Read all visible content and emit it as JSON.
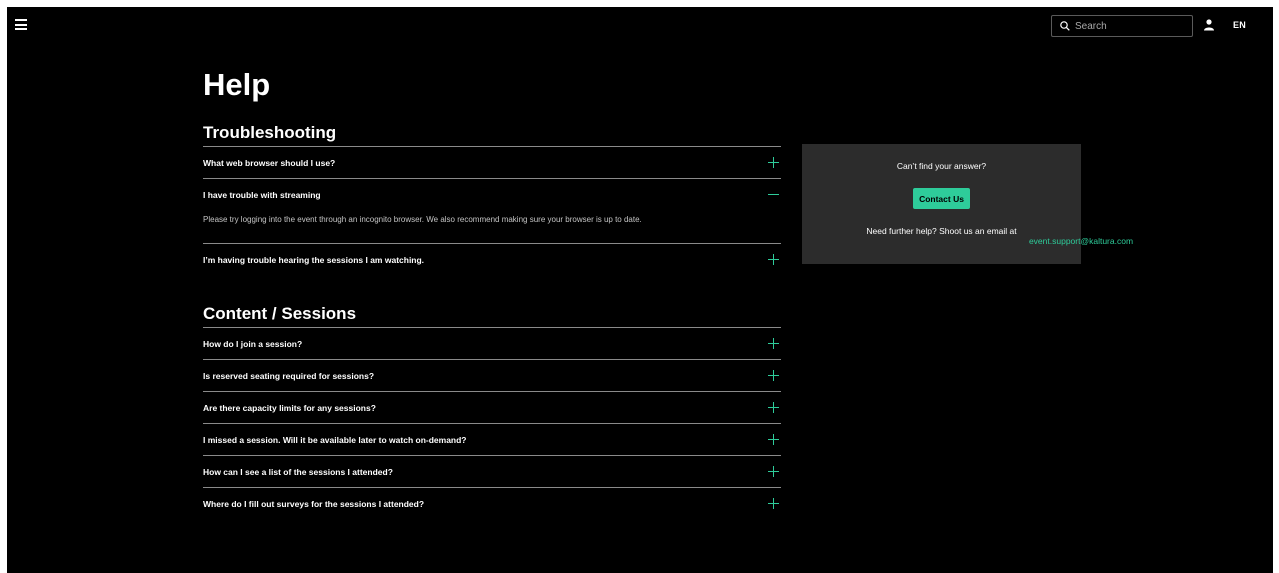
{
  "header": {
    "search_placeholder": "Search",
    "language": "EN"
  },
  "page_title": "Help",
  "sections": [
    {
      "title": "Troubleshooting",
      "items": [
        {
          "question": "What web browser should I use?",
          "expanded": false
        },
        {
          "question": "I have trouble with streaming",
          "expanded": true,
          "answer": "Please try logging into the event through an incognito browser. We also recommend making sure your browser is up to date."
        },
        {
          "question": "I’m having trouble hearing the sessions I am watching.",
          "expanded": false
        }
      ]
    },
    {
      "title": "Content / Sessions",
      "items": [
        {
          "question": "How do I join a session?",
          "expanded": false
        },
        {
          "question": "Is reserved seating required for sessions?",
          "expanded": false
        },
        {
          "question": "Are there capacity limits for any sessions?",
          "expanded": false
        },
        {
          "question": "I missed a session. Will it be available later to watch on-demand?",
          "expanded": false
        },
        {
          "question": "How can I see a list of the sessions I attended?",
          "expanded": false
        },
        {
          "question": "Where do I fill out surveys for the sessions I attended?",
          "expanded": false
        }
      ]
    }
  ],
  "help_card": {
    "prompt": "Can’t find your answer?",
    "contact_label": "Contact Us",
    "further_help": "Need further help? Shoot us an email at",
    "email": "event.support@kaltura.com"
  },
  "colors": {
    "accent": "#2ecc9a",
    "background": "#000000",
    "card": "#2c2c2c"
  },
  "icons": [
    "menu-icon",
    "search-icon",
    "user-icon",
    "plus-icon",
    "minus-icon"
  ]
}
